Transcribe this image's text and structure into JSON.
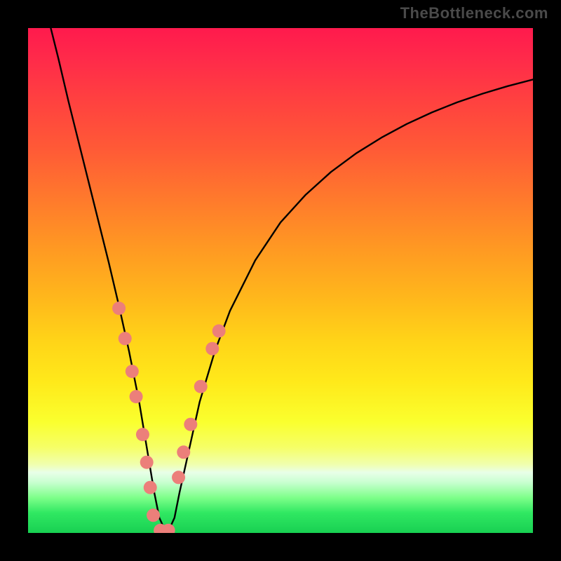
{
  "watermark": "TheBottleneck.com",
  "chart_data": {
    "type": "line",
    "title": "",
    "xlabel": "",
    "ylabel": "",
    "xlim": [
      0,
      100
    ],
    "ylim": [
      0,
      100
    ],
    "series": [
      {
        "name": "bottleneck-curve",
        "x": [
          4.5,
          6,
          8,
          10,
          12,
          14,
          16,
          18,
          20,
          22,
          23,
          24,
          25,
          26,
          27,
          28,
          29,
          30,
          32,
          34,
          37,
          40,
          45,
          50,
          55,
          60,
          65,
          70,
          75,
          80,
          85,
          90,
          95,
          100
        ],
        "y": [
          100,
          94,
          85.5,
          77.5,
          69.5,
          61.5,
          53.5,
          45,
          36,
          26,
          20,
          14,
          8,
          3,
          0.8,
          0.8,
          3,
          8,
          17,
          26,
          36,
          44,
          54,
          61.5,
          67,
          71.5,
          75.2,
          78.3,
          81,
          83.3,
          85.3,
          87,
          88.5,
          89.8
        ]
      }
    ],
    "markers": [
      {
        "name": "dots-left",
        "x": [
          18,
          19.2,
          20.6,
          21.4,
          22.7,
          23.5,
          24.2
        ],
        "y": [
          44.5,
          38.5,
          32,
          27,
          19.5,
          14,
          9
        ]
      },
      {
        "name": "dots-bottom",
        "x": [
          24.8,
          26.2,
          27.8
        ],
        "y": [
          3.5,
          0.5,
          0.5
        ]
      },
      {
        "name": "dots-right",
        "x": [
          29.8,
          30.8,
          32.2,
          34.2,
          36.5,
          37.8
        ],
        "y": [
          11,
          16,
          21.5,
          29,
          36.5,
          40
        ]
      }
    ],
    "colors": {
      "curve": "#000000",
      "marker_fill": "#ec7f7a",
      "marker_stroke": "#ec7f7a"
    }
  }
}
